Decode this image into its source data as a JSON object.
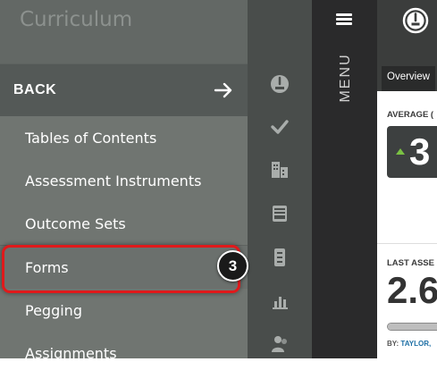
{
  "panel": {
    "title": "Curriculum",
    "back_label": "BACK",
    "items": [
      {
        "label": "Tables of Contents"
      },
      {
        "label": "Assessment Instruments"
      },
      {
        "label": "Outcome Sets"
      },
      {
        "label": "Forms"
      },
      {
        "label": "Pegging"
      },
      {
        "label": "Assignments"
      }
    ]
  },
  "callout": {
    "step": "3"
  },
  "rail": {
    "icons": [
      "gauge-icon",
      "checkmark-icon",
      "buildings-icon",
      "inbox-tray-icon",
      "cabinet-icon",
      "bar-chart-icon",
      "users-icon"
    ]
  },
  "menu": {
    "label": "MENU"
  },
  "content": {
    "tab_overview": "Overview",
    "average_label": "AVERAGE (",
    "average_value": "3",
    "last_label": "LAST ASSE",
    "last_value": "2.6",
    "progress_fraction": 0.98,
    "by_prefix": "BY: ",
    "by_author": "TAYLOR,"
  },
  "colors": {
    "highlight": "#e0191b",
    "trend_up": "#7ac143",
    "panel_bg": "#636865",
    "link": "#1d6fa5"
  }
}
